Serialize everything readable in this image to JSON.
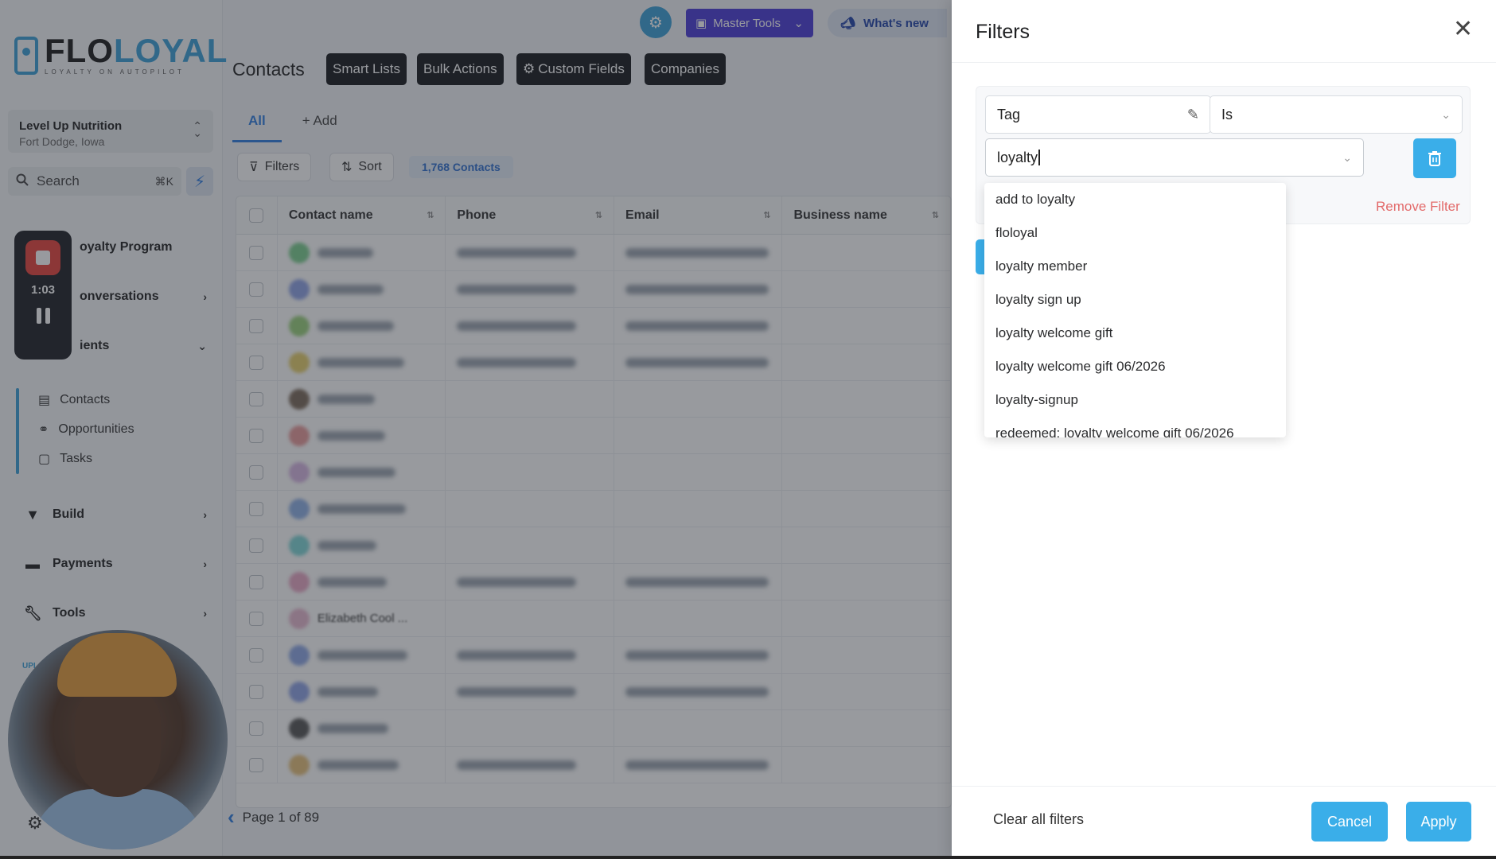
{
  "sidebar": {
    "logo_word_a": "FLO",
    "logo_word_b": "LOYAL",
    "logo_tagline": "LOYALTY ON AUTOPILOT",
    "location_name": "Level Up Nutrition",
    "location_city": "Fort Dodge, Iowa",
    "search_label": "Search",
    "search_shortcut": "⌘K",
    "nav": [
      {
        "label": "oyalty Program"
      },
      {
        "label": "onversations"
      },
      {
        "label": "ients"
      },
      {
        "label": "Build"
      },
      {
        "label": "Payments"
      },
      {
        "label": "Tools"
      }
    ],
    "subnav": [
      {
        "label": "Contacts"
      },
      {
        "label": "Opportunities"
      },
      {
        "label": "Tasks"
      }
    ],
    "upgrade_fragment": "UPI"
  },
  "recorder": {
    "time": "1:03"
  },
  "header": {
    "master_tools_label": "Master Tools",
    "whats_new_label": "What's new",
    "page_title": "Contacts",
    "buttons": [
      "Smart Lists",
      "Bulk Actions",
      "Custom Fields",
      "Companies"
    ]
  },
  "contacts": {
    "tab_all": "All",
    "tab_add": "+ Add",
    "filters_label": "Filters",
    "sort_label": "Sort",
    "count_label": "1,768 Contacts",
    "columns": [
      "Contact name",
      "Phone",
      "Email",
      "Business name"
    ],
    "visible_row_name": "Elizabeth Cool ...",
    "pagination": "Page 1 of 89"
  },
  "filters_drawer": {
    "title": "Filters",
    "field": "Tag",
    "operator": "Is",
    "value": "loyalty",
    "remove_filter_label": "Remove Filter",
    "options": [
      "add to loyalty",
      "floloyal",
      "loyalty member",
      "loyalty sign up",
      "loyalty welcome gift",
      "loyalty welcome gift 06/2026",
      "loyalty-signup",
      "redeemed: loyalty welcome gift 06/2026"
    ],
    "clear_all_label": "Clear all filters",
    "cancel_label": "Cancel",
    "apply_label": "Apply"
  },
  "colors": {
    "accent": "#3aaee9",
    "brand": "#3a9fd6",
    "master_tools": "#4a3ad6",
    "danger": "#e36a6a"
  }
}
